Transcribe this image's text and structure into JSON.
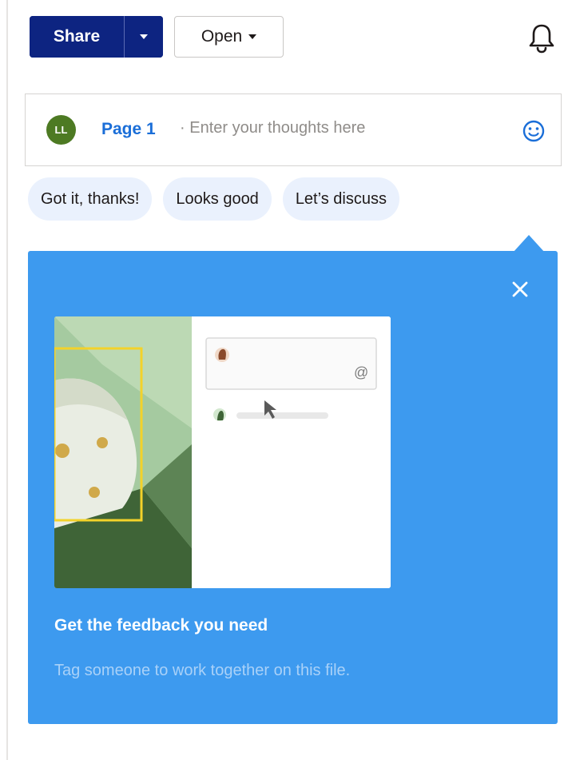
{
  "toolbar": {
    "share_label": "Share",
    "open_label": "Open"
  },
  "comment": {
    "avatar_initials": "LL",
    "page_label": "Page 1",
    "separator": "·",
    "placeholder": "Enter your thoughts here"
  },
  "quick_replies": [
    "Got it, thanks!",
    "Looks good",
    "Let’s discuss"
  ],
  "tip": {
    "title": "Get the feedback you need",
    "description": "Tag someone to work together on this file.",
    "mention_symbol": "@"
  },
  "colors": {
    "share": "#0d2481",
    "accent_link": "#1a6ed8",
    "tip_background": "#3d9aef",
    "chip_background": "#eaf1fd",
    "avatar": "#4d7a23"
  },
  "icons": {
    "notifications": "bell-icon",
    "emoji": "smiley-icon",
    "close": "close-icon"
  }
}
